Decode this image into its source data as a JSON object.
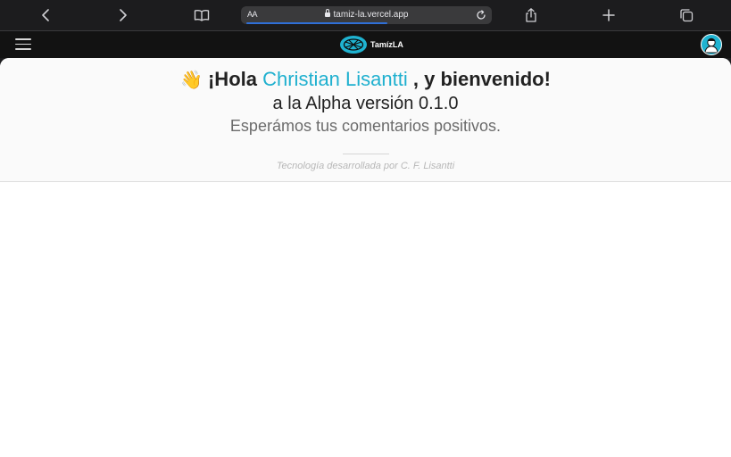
{
  "browser": {
    "reader_label": "AA",
    "url": "tamiz-la.vercel.app"
  },
  "navbar": {
    "brand": "TamízLA"
  },
  "hero": {
    "greeting_prefix": "¡Hola",
    "username": "Christian Lisantti",
    "greeting_suffix": ", y bienvenido!",
    "version_line": "a la Alpha versión 0.1.0",
    "subtitle": "Esperámos tus comentarios positivos.",
    "credit": "Tecnología desarrollada por C. F. Lisantti"
  },
  "colors": {
    "accent": "#1fb0cf",
    "navbar_bg": "#121212",
    "browser_bg": "#1c1c1e"
  },
  "icons": [
    "back-icon",
    "forward-icon",
    "bookmarks-icon",
    "lock-icon",
    "reload-icon",
    "share-icon",
    "new-tab-icon",
    "tabs-icon",
    "menu-icon",
    "brand-logo-icon",
    "wave-emoji-icon"
  ]
}
